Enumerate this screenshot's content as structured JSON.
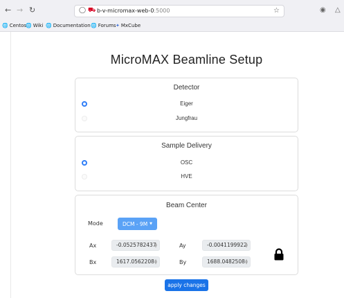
{
  "browser": {
    "url_host": "b-v-micromax-web-0",
    "url_port": ":5000",
    "bookmarks": [
      "Centos",
      "Wiki",
      "Documentation",
      "Forums",
      "MxCube"
    ]
  },
  "page": {
    "title": "MicroMAX Beamline Setup"
  },
  "detector": {
    "title": "Detector",
    "options": [
      {
        "label": "Eiger",
        "selected": true
      },
      {
        "label": "Jungfrau",
        "selected": false
      }
    ]
  },
  "sample_delivery": {
    "title": "Sample Delivery",
    "options": [
      {
        "label": "OSC",
        "selected": true
      },
      {
        "label": "HVE",
        "selected": false
      }
    ]
  },
  "beam_center": {
    "title": "Beam Center",
    "mode_label": "Mode",
    "mode_value": "DCM - 9M",
    "ax_label": "Ax",
    "ax_value": "-0.0525782437",
    "ay_label": "Ay",
    "ay_value": "-0.0041199922",
    "bx_label": "Bx",
    "bx_value": "1617.0562208",
    "by_label": "By",
    "by_value": "1688.0482508"
  },
  "actions": {
    "apply_label": "apply changes"
  },
  "colors": {
    "accent": "#2f7ef7",
    "mode_button": "#5aa2f6",
    "apply_button": "#1a73e8"
  }
}
